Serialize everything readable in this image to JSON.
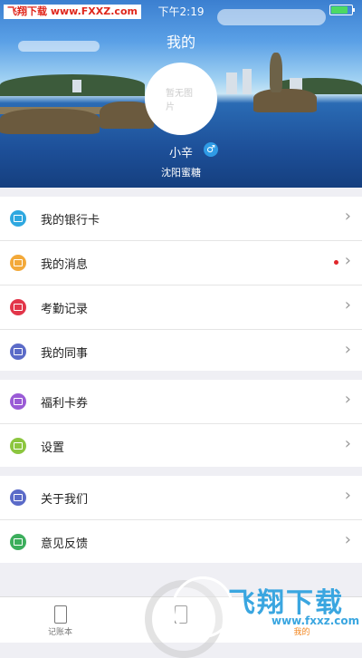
{
  "statusbar": {
    "watermark": "飞翔下载 www.FXXZ.com",
    "time": "下午2:19"
  },
  "header": {
    "title": "我的"
  },
  "profile": {
    "avatar_placeholder": "暂无图片",
    "name": "小辛",
    "gender_symbol": "♂",
    "city": "沈阳蜜糖"
  },
  "menu": {
    "group1": [
      {
        "label": "我的银行卡",
        "icon": "bank-card-icon",
        "color": "#2fa8e0"
      },
      {
        "label": "我的消息",
        "icon": "message-icon",
        "color": "#f3a93a"
      },
      {
        "label": "考勤记录",
        "icon": "calendar-icon",
        "color": "#e2364a"
      },
      {
        "label": "我的同事",
        "icon": "colleague-icon",
        "color": "#5b6bc8"
      }
    ],
    "group2": [
      {
        "label": "福利卡券",
        "icon": "coupon-icon",
        "color": "#9a5bd6"
      },
      {
        "label": "设置",
        "icon": "settings-icon",
        "color": "#8cc63f"
      }
    ],
    "group3": [
      {
        "label": "关于我们",
        "icon": "about-icon",
        "color": "#5b6bc8"
      },
      {
        "label": "意见反馈",
        "icon": "feedback-icon",
        "color": "#3cae5c"
      }
    ]
  },
  "tabbar": {
    "tabs": [
      {
        "label": "记账本",
        "icon": "ledger-icon"
      },
      {
        "label": "",
        "icon": "middle-tab-icon"
      },
      {
        "label": "我的",
        "icon": "profile-icon"
      }
    ]
  },
  "bottom_watermark": {
    "title": "飞翔下载",
    "url": "www.fxxz.com"
  },
  "colors": {
    "accent": "#f2851e",
    "unread_dot": "#e0262a",
    "watermark_blue": "#3aa6e0"
  }
}
